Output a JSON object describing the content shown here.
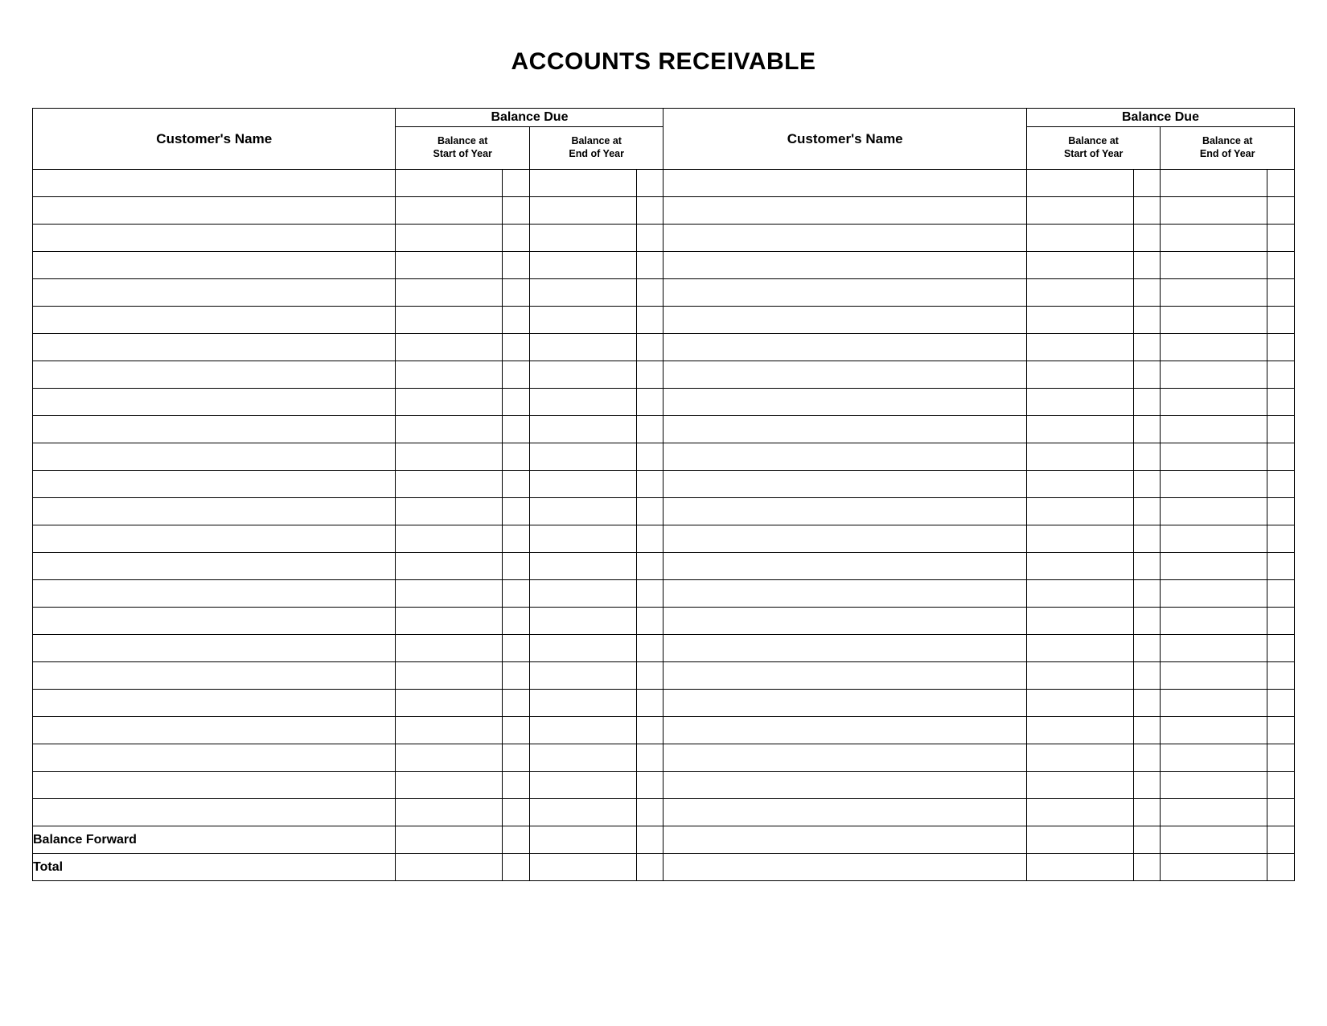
{
  "title": "ACCOUNTS RECEIVABLE",
  "headers": {
    "customer_name": "Customer's Name",
    "balance_due": "Balance Due",
    "balance_start_line1": "Balance at",
    "balance_start_line2": "Start of Year",
    "balance_end_line1": "Balance at",
    "balance_end_line2": "End of Year"
  },
  "footer": {
    "balance_forward": "Balance Forward",
    "total": "Total"
  },
  "blank_row_count": 24
}
